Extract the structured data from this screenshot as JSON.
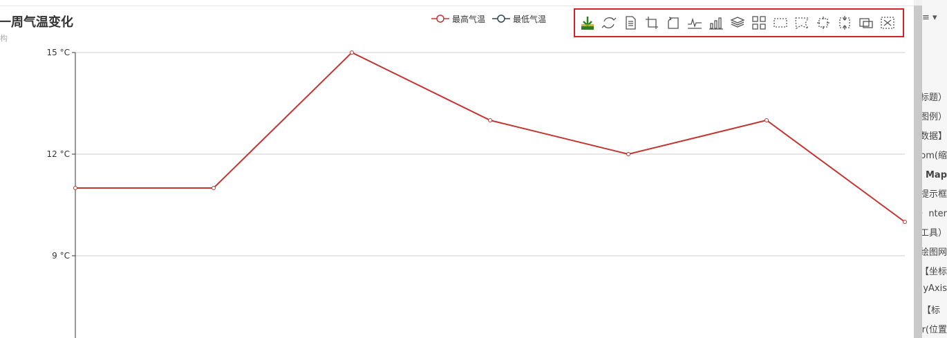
{
  "chart_data": {
    "type": "line",
    "title": "一周气温变化",
    "subtitle": "构",
    "x": [
      "",
      "",
      "",
      "",
      "",
      "",
      ""
    ],
    "series": [
      {
        "name": "最高气温",
        "values": [
          11,
          11,
          15,
          13,
          12,
          13,
          10
        ],
        "color": "#c23531"
      },
      {
        "name": "最低气温",
        "values": [],
        "color": "#2f4554"
      }
    ],
    "yticks": [
      "15 °C",
      "12 °C",
      "9 °C"
    ],
    "ytick_values": [
      15,
      12,
      9
    ],
    "ylim": [
      6,
      15
    ],
    "grid": true,
    "legend": "top"
  },
  "toolbox": {
    "border_color": "#d8202a",
    "tools": [
      {
        "name": "save-as-image-icon"
      },
      {
        "name": "restore-icon"
      },
      {
        "name": "data-view-icon"
      },
      {
        "name": "data-zoom-icon"
      },
      {
        "name": "zoom-back-icon"
      },
      {
        "name": "line-chart-icon"
      },
      {
        "name": "bar-chart-icon"
      },
      {
        "name": "stack-icon"
      },
      {
        "name": "tiled-icon"
      },
      {
        "name": "rect-select-icon"
      },
      {
        "name": "polygon-select-icon"
      },
      {
        "name": "keep-select-icon"
      },
      {
        "name": "clear-select-icon"
      },
      {
        "name": "brush-lasso-icon"
      },
      {
        "name": "clear-brush-icon"
      }
    ]
  },
  "side_panel": {
    "menu_icon": "≡ ▾",
    "items": [
      {
        "text": "（标题）",
        "bold": false
      },
      {
        "text": "（图例",
        "bold": false
      },
      {
        "text": "【数据】",
        "bold": false
      },
      {
        "text": "zoom(缩",
        "bold": false
      },
      {
        "text": "Map（",
        "bold": true
      },
      {
        "text": "提示框",
        "bold": false
      },
      {
        "text": "nter（",
        "bold": false
      },
      {
        "text": "（工具",
        "bold": false
      },
      {
        "text": "绘图网",
        "bold": false
      },
      {
        "text": "坐标】",
        "bold": false
      },
      {
        "text": "s,yAxis",
        "bold": false
      },
      {
        "text": "标】",
        "bold": false
      },
      {
        "text": "r(位置",
        "bold": false
      }
    ]
  }
}
